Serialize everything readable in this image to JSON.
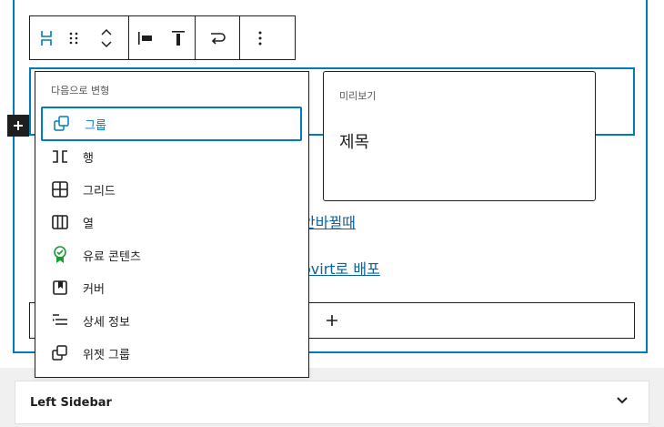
{
  "menu": {
    "heading": "다음으로 변형",
    "items": [
      {
        "label": "그룹",
        "icon": "group-icon",
        "selected": true
      },
      {
        "label": "행",
        "icon": "row-icon"
      },
      {
        "label": "그리드",
        "icon": "grid-icon"
      },
      {
        "label": "열",
        "icon": "columns-icon"
      },
      {
        "label": "유료 콘텐츠",
        "icon": "paid-content-badge-icon"
      },
      {
        "label": "커버",
        "icon": "cover-icon"
      },
      {
        "label": "상세 정보",
        "icon": "details-icon"
      },
      {
        "label": "위젯 그룹",
        "icon": "widget-group-icon"
      }
    ]
  },
  "preview": {
    "label": "미리보기",
    "title": "제목"
  },
  "background_links": [
    {
      "text": "안바뀔때"
    },
    {
      "text": "ovirt로 배포"
    }
  ],
  "panel": {
    "title": "Left Sidebar"
  },
  "colors": {
    "accent": "#007cba",
    "paid_content_icon": "#1a9c2f",
    "text": "#1e1e1e"
  }
}
